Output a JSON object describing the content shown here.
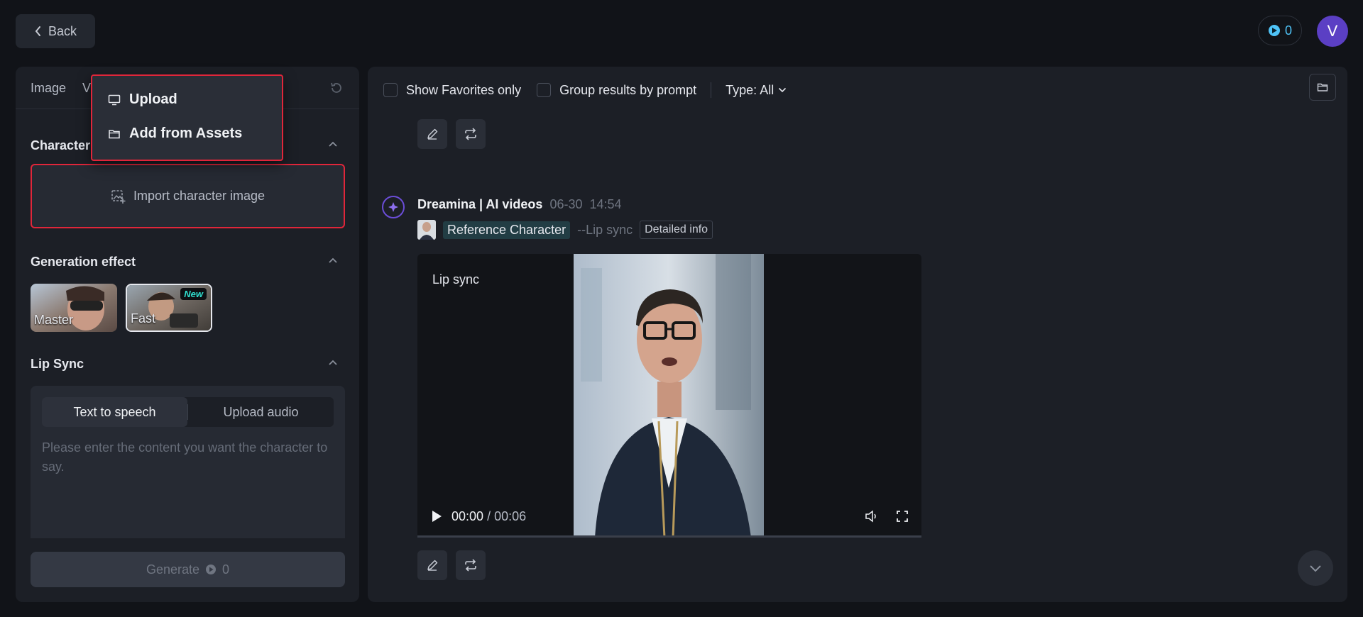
{
  "header": {
    "back_label": "Back",
    "credits": "0",
    "avatar_letter": "V"
  },
  "left_panel": {
    "tabs": [
      {
        "label": "Image"
      },
      {
        "label": "V"
      }
    ],
    "character_title": "Character",
    "import_label": "Import character image",
    "generation_effect_title": "Generation effect",
    "effects": [
      {
        "label": "Master"
      },
      {
        "label": "Fast",
        "badge": "New"
      }
    ],
    "lip_sync_title": "Lip Sync",
    "lip_sync_tabs": [
      "Text to speech",
      "Upload audio"
    ],
    "lip_sync_placeholder": "Please enter the content you want the character to say.",
    "generate_label": "Generate",
    "generate_cost": "0"
  },
  "upload_menu": {
    "items": [
      {
        "label": "Upload",
        "icon": "monitor-icon"
      },
      {
        "label": "Add from Assets",
        "icon": "folder-icon"
      }
    ]
  },
  "main": {
    "filters": {
      "favorites_label": "Show Favorites only",
      "group_label": "Group results by prompt",
      "type_label": "Type: All"
    },
    "result": {
      "author": "Dreamina | AI videos",
      "date": "06-30",
      "time": "14:54",
      "reference_label": "Reference Character",
      "mode": "--Lip sync",
      "detail_label": "Detailed info",
      "video_label": "Lip sync",
      "current_time": "00:00",
      "duration": "/ 00:06"
    }
  },
  "colors": {
    "background": "#111318",
    "panel": "#1c1f26",
    "highlight": "#e0263a",
    "credit_accent": "#4fc3f7",
    "avatar": "#5b3fc4"
  }
}
